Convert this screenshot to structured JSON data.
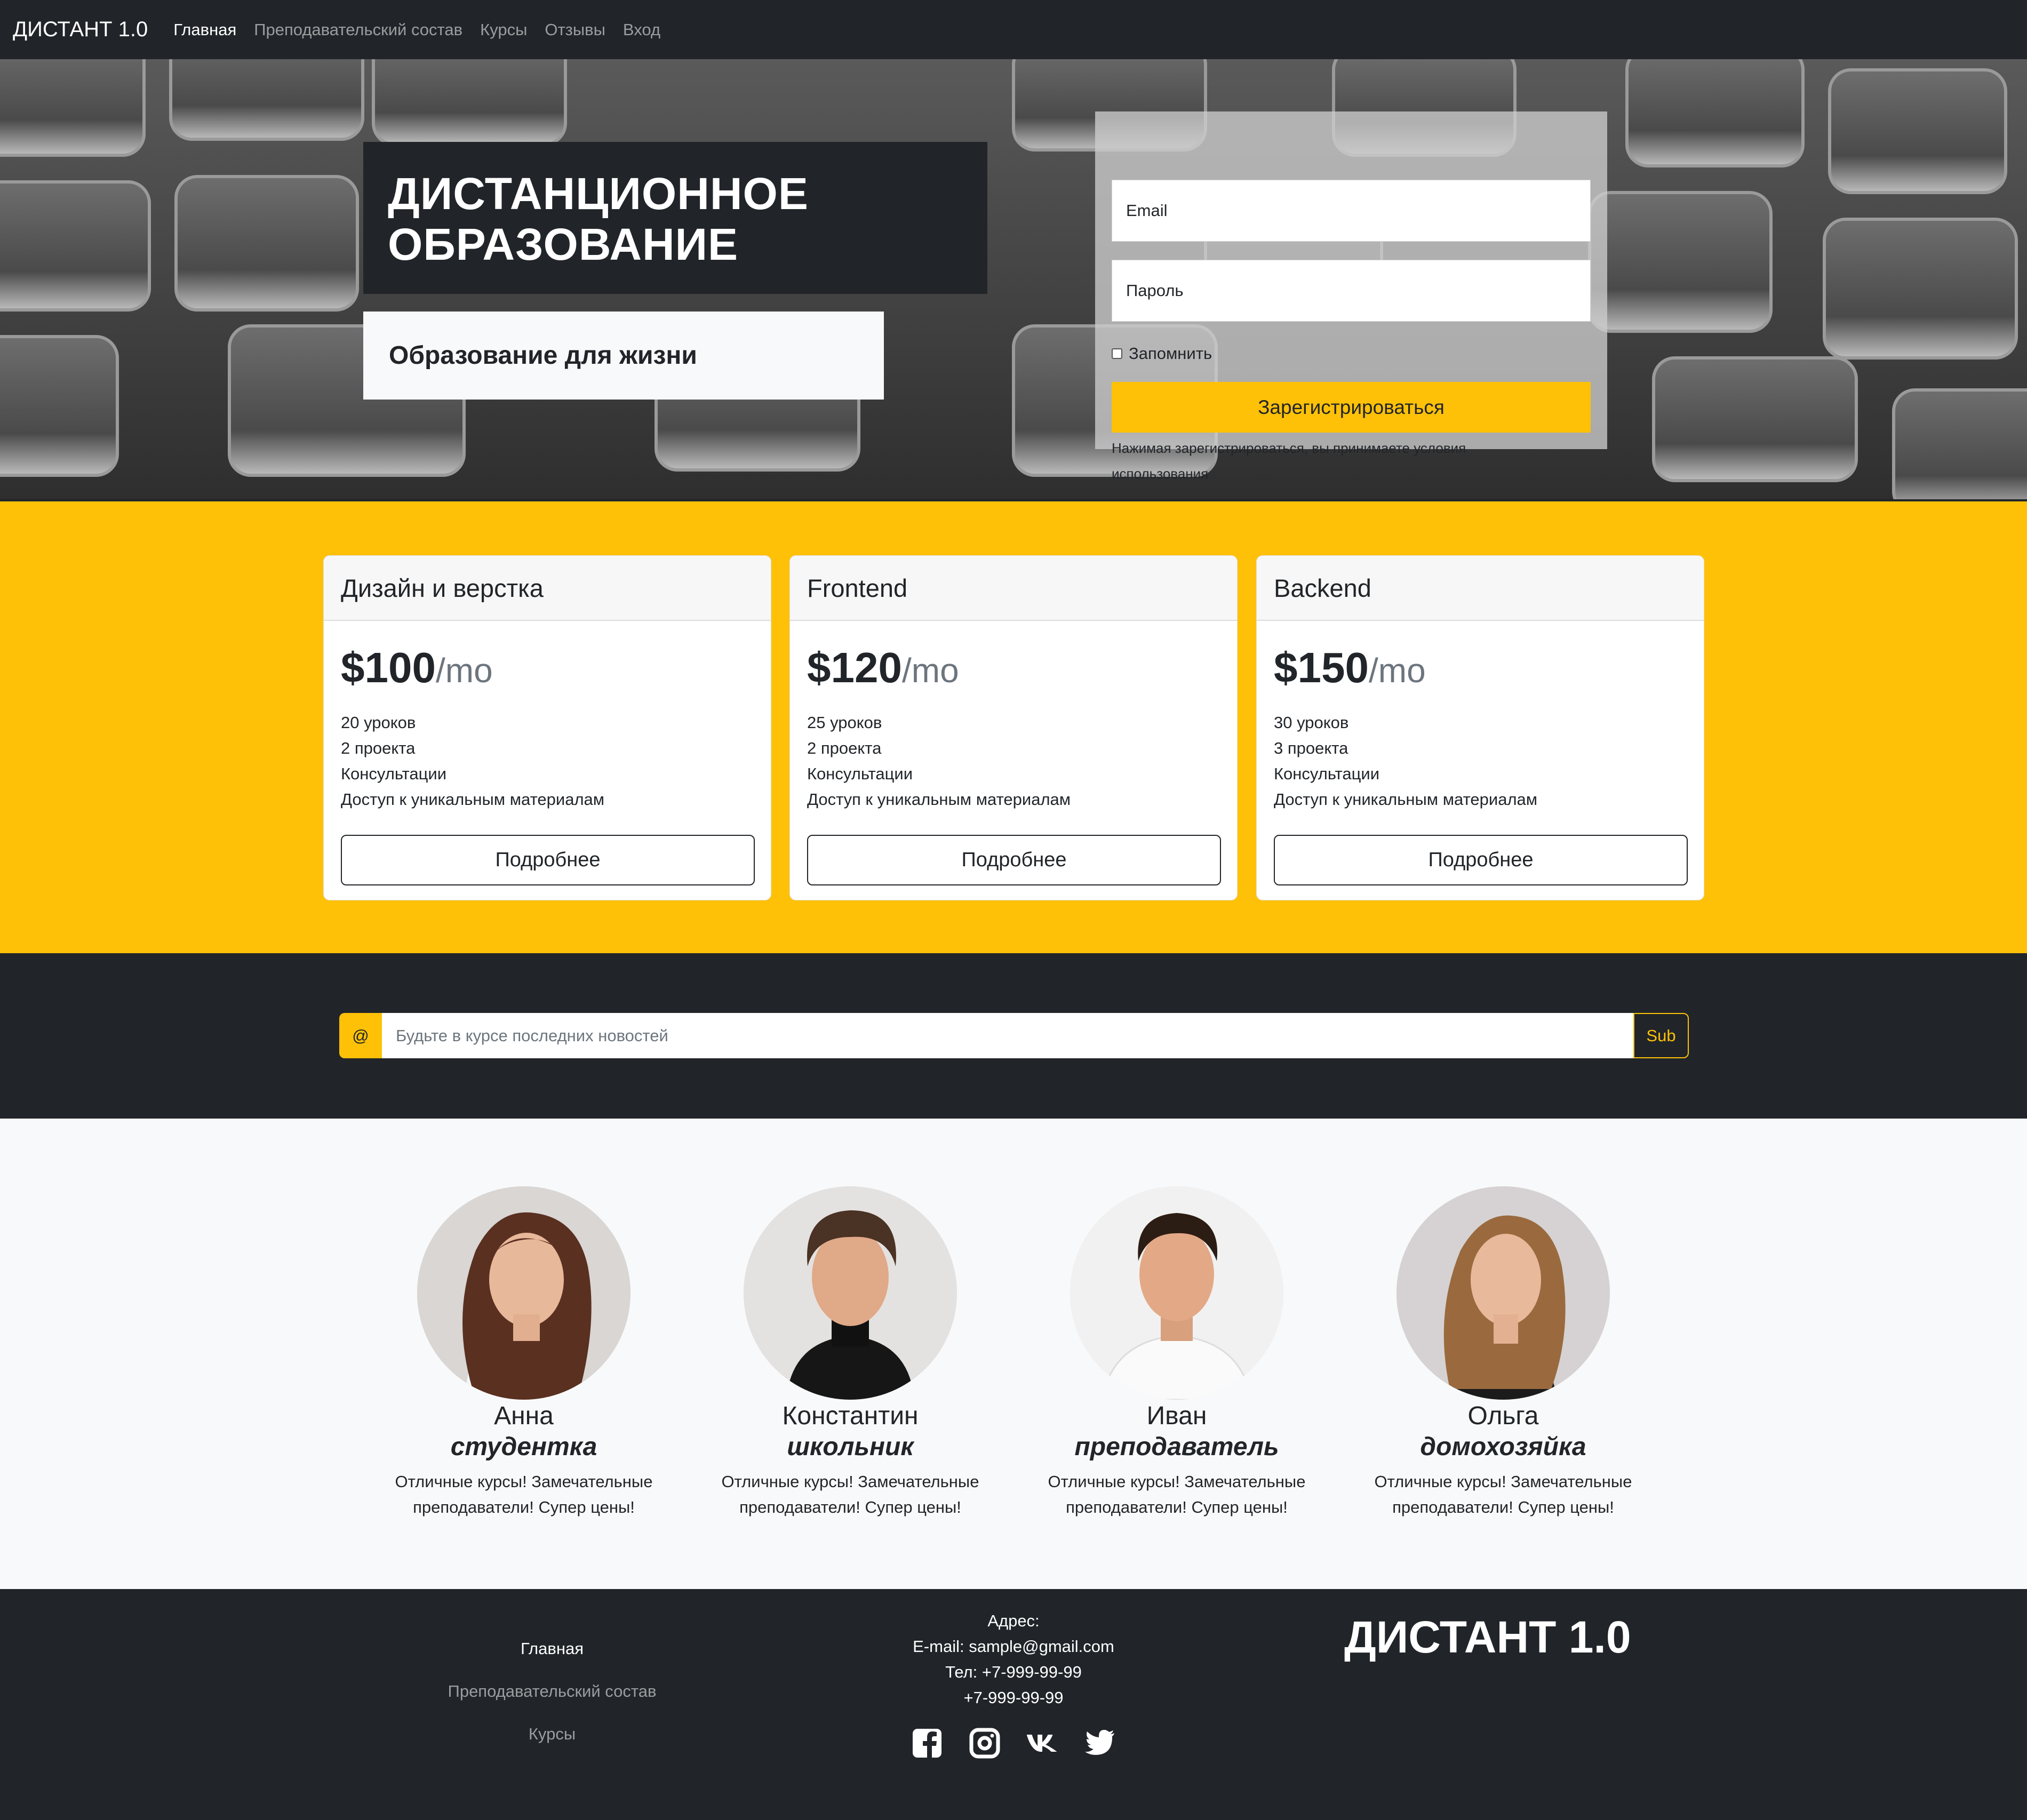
{
  "navbar": {
    "brand": "ДИСТАНТ 1.0",
    "links": [
      "Главная",
      "Преподавательский состав",
      "Курсы",
      "Отзывы",
      "Вход"
    ]
  },
  "hero": {
    "title_line1": "ДИСТАНЦИОННОЕ",
    "title_line2": "ОБРАЗОВАНИЕ",
    "subtitle": "Образование для жизни",
    "form": {
      "email_placeholder": "Email",
      "password_placeholder": "Пароль",
      "remember_label": "Запомнить",
      "submit_label": "Зарегистрироваться",
      "terms_text": "Нажимая зарегистрироваться, вы принимаете условия использования"
    }
  },
  "pricing": {
    "cards": [
      {
        "title": "Дизайн и верстка",
        "price": "$100",
        "period": "/mo",
        "features": [
          "20 уроков",
          "2 проекта",
          "Консультации",
          "Доступ к уникальным материалам"
        ],
        "button": "Подробнее"
      },
      {
        "title": "Frontend",
        "price": "$120",
        "period": "/mo",
        "features": [
          "25 уроков",
          "2 проекта",
          "Консультации",
          "Доступ к уникальным материалам"
        ],
        "button": "Подробнее"
      },
      {
        "title": "Backend",
        "price": "$150",
        "period": "/mo",
        "features": [
          "30 уроков",
          "3 проекта",
          "Консультации",
          "Доступ к уникальным материалам"
        ],
        "button": "Подробнее"
      }
    ]
  },
  "newsletter": {
    "prefix": "@",
    "placeholder": "Будьте в курсе последних новостей",
    "button": "Sub"
  },
  "testimonials": [
    {
      "name": "Анна",
      "role": "студентка",
      "text": "Отличные курсы! Замечательные преподаватели! Супер цены!"
    },
    {
      "name": "Константин",
      "role": "школьник",
      "text": "Отличные курсы! Замечательные преподаватели! Супер цены!"
    },
    {
      "name": "Иван",
      "role": "преподаватель",
      "text": "Отличные курсы! Замечательные преподаватели! Супер цены!"
    },
    {
      "name": "Ольга",
      "role": "домохозяйка",
      "text": "Отличные курсы! Замечательные преподаватели! Супер цены!"
    }
  ],
  "footer": {
    "links": [
      "Главная",
      "Преподавательский состав",
      "Курсы"
    ],
    "address_label": "Адрес:",
    "email": "E-mail: sample@gmail.com",
    "phone1": "Тел: +7-999-99-99",
    "phone2": "+7-999-99-99",
    "social_icons": [
      "facebook-icon",
      "instagram-icon",
      "vk-icon",
      "twitter-icon"
    ],
    "brand": "ДИСТАНТ 1.0"
  },
  "colors": {
    "dark": "#212529",
    "accent": "#ffc107",
    "light": "#f8f9fa"
  }
}
